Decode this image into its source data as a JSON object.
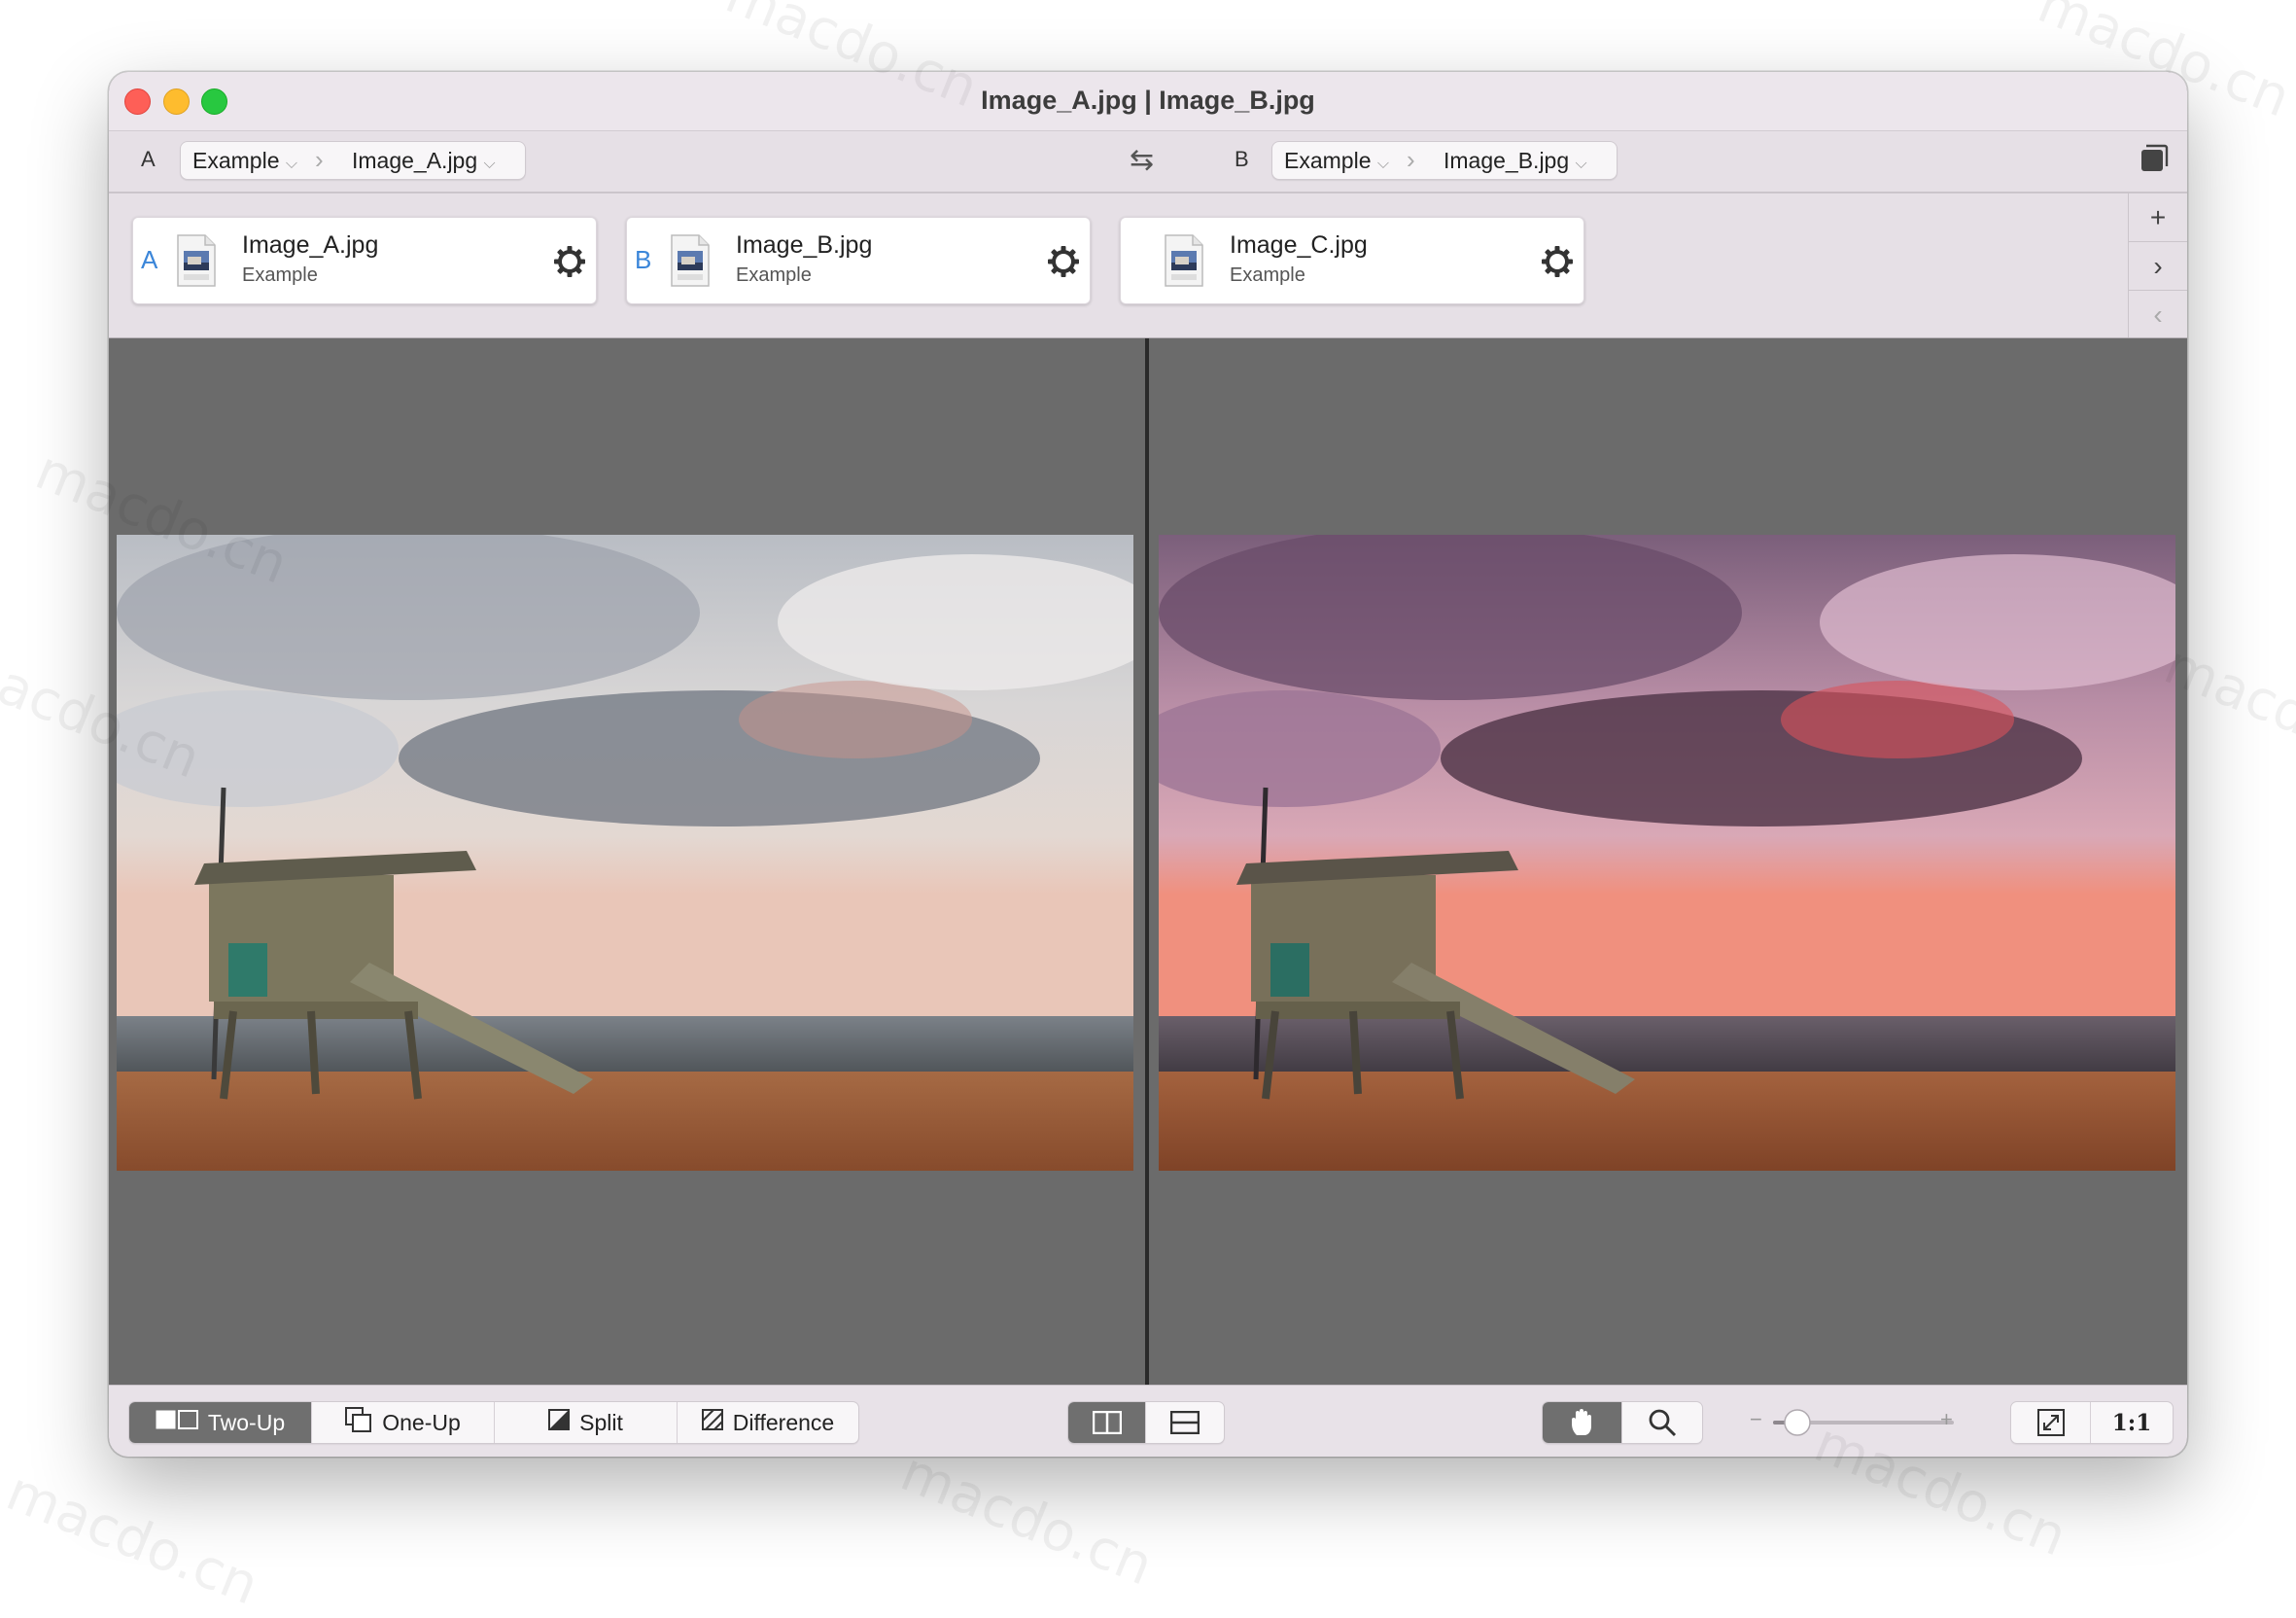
{
  "window": {
    "title": "Image_A.jpg | Image_B.jpg"
  },
  "pathbar": {
    "a": {
      "letter": "A",
      "folder": "Example",
      "file": "Image_A.jpg"
    },
    "b": {
      "letter": "B",
      "folder": "Example",
      "file": "Image_B.jpg"
    },
    "swap_icon": "swap-arrows-icon",
    "window_icon": "sidebar-window-icon"
  },
  "files": [
    {
      "letter": "A",
      "name": "Image_A.jpg",
      "folder": "Example"
    },
    {
      "letter": "B",
      "name": "Image_B.jpg",
      "folder": "Example"
    },
    {
      "letter": "",
      "name": "Image_C.jpg",
      "folder": "Example"
    }
  ],
  "tabs_side": {
    "add": "+",
    "next": "›",
    "prev": "‹"
  },
  "modes": {
    "two_up": "Two-Up",
    "one_up": "One-Up",
    "split": "Split",
    "difference": "Difference",
    "active": "two_up"
  },
  "layout_toggle": {
    "active": "side-by-side"
  },
  "tools": {
    "active": "hand"
  },
  "zoom": {
    "minus": "−",
    "plus": "+",
    "value": 0.1,
    "actual_size": "1:1"
  },
  "watermark": "macdo.cn",
  "colors": {
    "accent": "#3b86d9",
    "active_segment": "#6f6f6f",
    "canvas": "#6b6b6b"
  }
}
